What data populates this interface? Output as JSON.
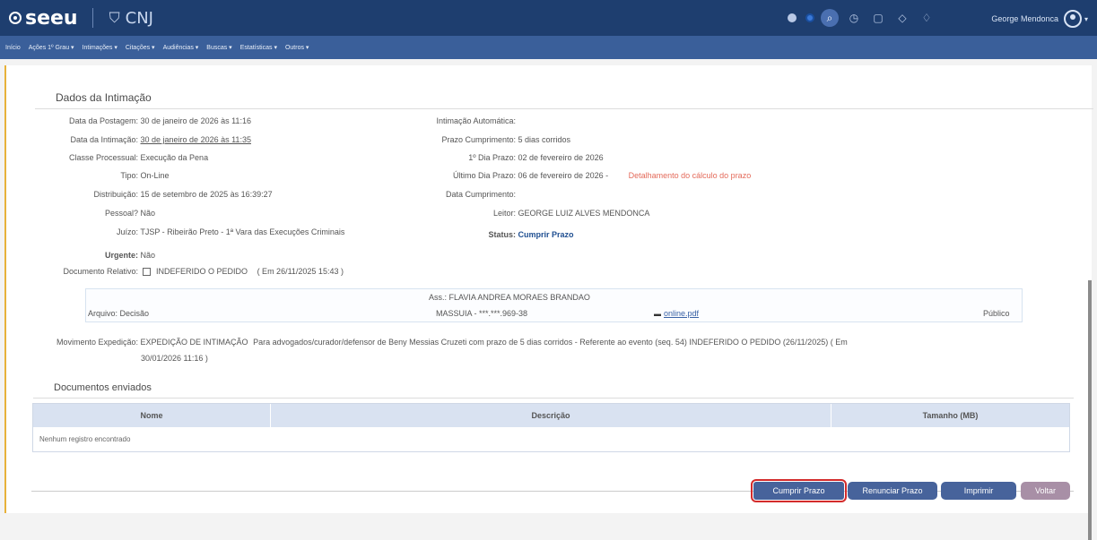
{
  "topbar": {
    "brand": "seeu",
    "partner": "CNJ",
    "user_name": "George Mendonca"
  },
  "menu": [
    "Início",
    "Ações 1º Grau ▾",
    "Intimações ▾",
    "Citações ▾",
    "Audiências ▾",
    "Buscas ▾",
    "Estatísticas ▾",
    "Outros ▾"
  ],
  "section_title": "Dados da Intimação",
  "left_fields": [
    {
      "label": "Data da Postagem:",
      "value": "30 de janeiro de 2026 às 11:16"
    },
    {
      "label": "Data da Intimação:",
      "value": "30 de janeiro de 2026 às 11:35"
    },
    {
      "label": "Classe Processual:",
      "value": "Execução da Pena"
    },
    {
      "label": "Tipo:",
      "value": "On-Line"
    },
    {
      "label": "Distribuição:",
      "value": "15 de setembro de 2025 às 16:39:27"
    },
    {
      "label": "Pessoal?",
      "value": "Não"
    },
    {
      "label": "Juízo:",
      "value": "TJSP - Ribeirão Preto - 1ª Vara das Execuções Criminais"
    },
    {
      "label": "Urgente:",
      "value": "Não"
    }
  ],
  "right_fields": [
    {
      "label": "Intimação Automática:",
      "value": ""
    },
    {
      "label": "Prazo Cumprimento:",
      "value": "5 dias corridos"
    },
    {
      "label": "1º Dia Prazo:",
      "value": "02 de fevereiro de 2026"
    },
    {
      "label": "Último Dia Prazo:",
      "value": "06 de fevereiro de 2026 -"
    },
    {
      "label": "Data Cumprimento:",
      "value": ""
    },
    {
      "label": "Leitor:",
      "value": "GEORGE LUIZ ALVES MENDONCA"
    },
    {
      "label": "Status:",
      "value": "Cumprir Prazo"
    }
  ],
  "deadline_link": "Detalhamento do cálculo do prazo",
  "documento_relativo": {
    "label": "Documento Relativo:",
    "value": "INDEFERIDO O PEDIDO",
    "date": "( Em 26/11/2025 15:43 )"
  },
  "file": {
    "signed_by": "Ass.: FLAVIA ANDREA MORAES BRANDAO",
    "label": "Arquivo: Decisão",
    "signer_id": "MASSUIA - ***.***.969-38",
    "filename": "online.pdf",
    "visibility": "Público"
  },
  "movimento": {
    "label": "Movimento Expedição:",
    "text_bold": "EXPEDIÇÃO DE INTIMAÇÃO",
    "text": "Para advogados/curador/defensor de Beny Messias Cruzeti com prazo de 5 dias corridos - Referente ao evento (seq. 54) INDEFERIDO O PEDIDO (26/11/2025) ( Em",
    "text_cont": "30/01/2026 11:16 )"
  },
  "docs_title": "Documentos enviados",
  "table": {
    "headers": [
      "Nome",
      "Descrição",
      "Tamanho (MB)"
    ],
    "empty": "Nenhum registro encontrado"
  },
  "buttons": {
    "cumprir": "Cumprir Prazo",
    "renunciar": "Renunciar Prazo",
    "imprimir": "Imprimir",
    "voltar": "Voltar"
  }
}
